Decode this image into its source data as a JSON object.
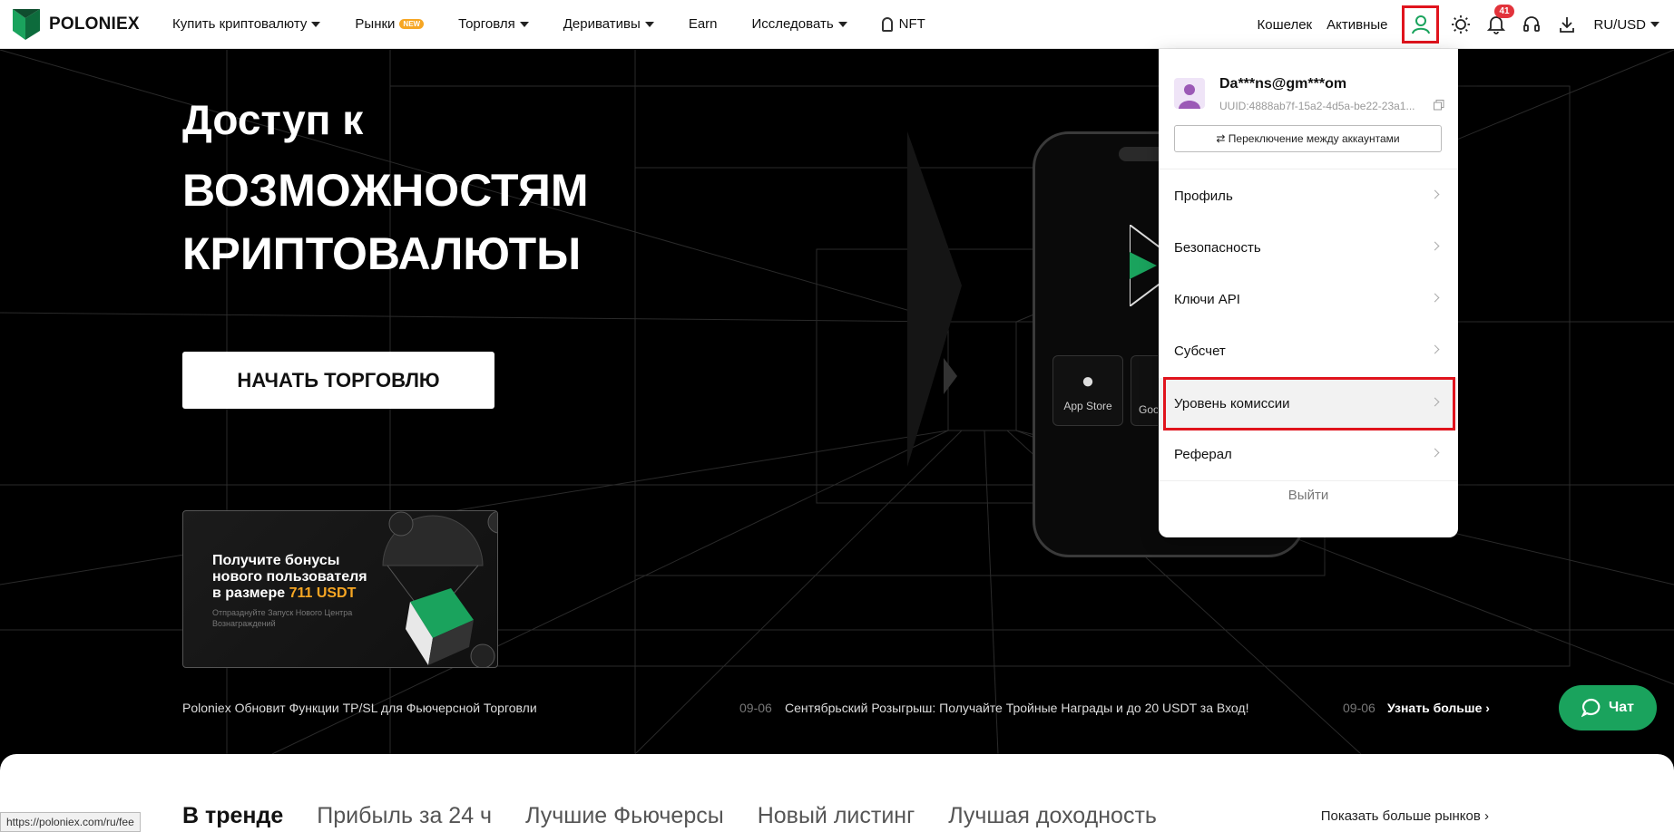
{
  "nav": {
    "logo_text": "POLONIEX",
    "items": [
      {
        "label": "Купить криптовалюту",
        "has_caret": true
      },
      {
        "label": "Рынки",
        "badge": "NEW"
      },
      {
        "label": "Торговля",
        "has_caret": true
      },
      {
        "label": "Деривативы",
        "has_caret": true
      },
      {
        "label": "Earn"
      },
      {
        "label": "Исследовать",
        "has_caret": true
      },
      {
        "label": "NFT"
      }
    ],
    "wallet": "Кошелек",
    "assets": "Активные",
    "notifications_count": "41",
    "currency": "RU/USD"
  },
  "hero": {
    "title_line1": "Доступ к",
    "title_line2": "ВОЗМОЖНОСТЯМ",
    "title_line3": "КРИПТОВАЛЮТЫ",
    "cta": "НАЧАТЬ ТОРГОВЛЮ",
    "appstore": "App Store",
    "googleplay": "Goo",
    "promo": {
      "line1": "Получите бонусы",
      "line2": "нового пользователя",
      "line3_prefix": "в размере ",
      "line3_accent": "711 USDT",
      "sub": "Отпразднуйте Запуск Нового Центра Вознаграждений"
    },
    "ticker": [
      {
        "text": "Poloniex Обновит Функции TP/SL для Фьючерсной Торговли",
        "date": "09-06"
      },
      {
        "text": "Сентябрьский Розыгрыш: Получайте Тройные Награды и до 20 USDT за Вход!",
        "date": "09-06"
      }
    ],
    "learn_more": "Узнать больше ›"
  },
  "dropdown": {
    "email": "Da***ns@gm***om",
    "uid": "UUID:4888ab7f-15a2-4d5a-be22-23a1...",
    "switch_label": "⇄ Переключение между аккаунтами",
    "items": [
      {
        "label": "Профиль"
      },
      {
        "label": "Безопасность"
      },
      {
        "label": "Ключи API"
      },
      {
        "label": "Субсчет"
      },
      {
        "label": "Уровень комиссии",
        "highlighted": true
      },
      {
        "label": "Реферал"
      }
    ],
    "logout": "Выйти"
  },
  "chat": {
    "label": "Чат"
  },
  "markets": {
    "tabs": [
      {
        "label": "В тренде",
        "active": true
      },
      {
        "label": "Прибыль за 24 ч"
      },
      {
        "label": "Лучшие Фьючерсы"
      },
      {
        "label": "Новый листинг"
      },
      {
        "label": "Лучшая доходность"
      }
    ],
    "more": "Показать больше рынков ›"
  },
  "status_url": "https://poloniex.com/ru/fee",
  "colors": {
    "brand_green": "#1aa35d",
    "accent_orange": "#f6a623",
    "highlight_red": "#e0141d"
  },
  "icons": [
    "poloniex-logo-icon",
    "user-icon",
    "theme-sun-icon",
    "bell-icon",
    "headset-icon",
    "download-icon",
    "apple-icon",
    "copy-icon",
    "chat-bubble-icon",
    "chevron-right-icon"
  ]
}
